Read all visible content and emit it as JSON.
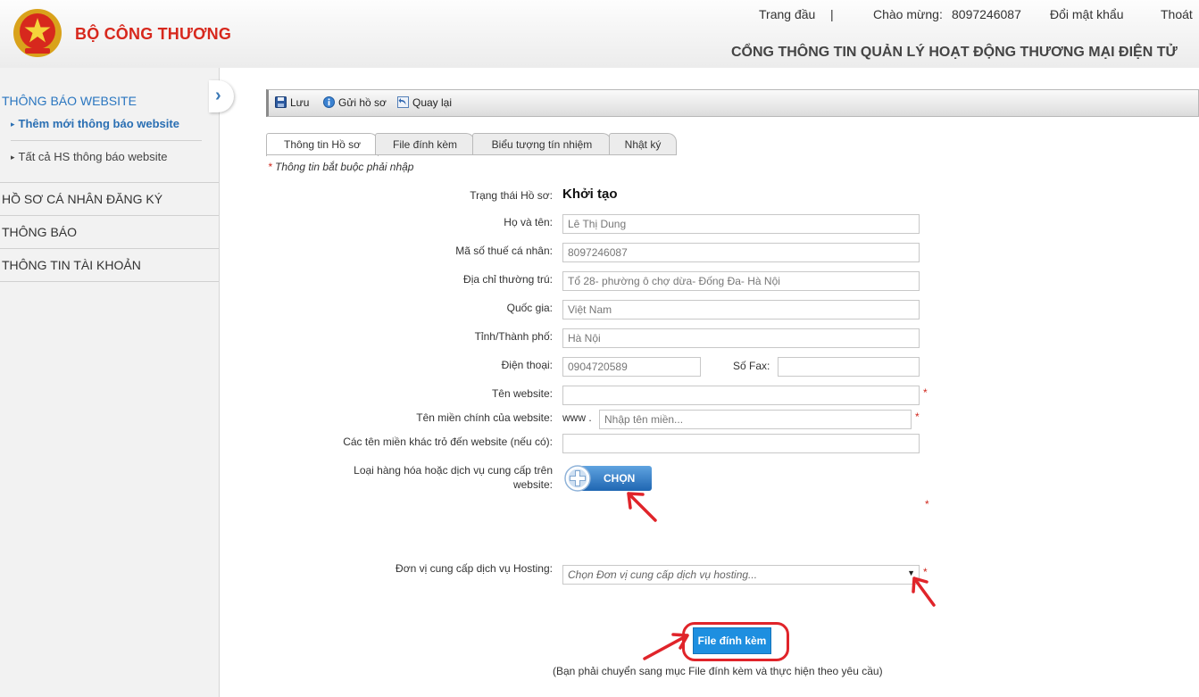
{
  "header": {
    "brand": "BỘ CÔNG THƯƠNG",
    "home_link": "Trang đầu",
    "separator": "|",
    "greeting_label": "Chào mừng:",
    "username": "8097246087",
    "change_password": "Đổi mật khẩu",
    "logout": "Thoát",
    "portal_title": "CỔNG THÔNG TIN QUẢN LÝ HOẠT ĐỘNG THƯƠNG MẠI ĐIỆN TỬ"
  },
  "sidebar": {
    "website_notice": {
      "title": "THÔNG BÁO WEBSITE",
      "items": [
        "Thêm mới thông báo website",
        "Tất cả HS thông báo website"
      ]
    },
    "sections": [
      "HỒ SƠ CÁ NHÂN ĐĂNG KÝ",
      "THÔNG BÁO",
      "THÔNG TIN TÀI KHOẢN"
    ]
  },
  "toolbar": {
    "save": "Lưu",
    "submit": "Gửi hồ sơ",
    "back": "Quay lại"
  },
  "tabs": [
    "Thông tin Hồ sơ",
    "File đính kèm",
    "Biểu tượng tín nhiệm",
    "Nhật ký"
  ],
  "form": {
    "required_star": "*",
    "required_note": "Thông tin bắt buộc phải nhập",
    "status_label": "Trạng thái Hồ sơ:",
    "status_value": "Khởi tạo",
    "fullname_label": "Họ và tên:",
    "fullname_value": "Lê Thị Dung",
    "tax_label": "Mã số thuế cá nhân:",
    "tax_value": "8097246087",
    "address_label": "Địa chỉ thường trú:",
    "address_value": "Tổ 28- phường ô chợ dừa- Đống Đa- Hà Nội",
    "country_label": "Quốc gia:",
    "country_value": "Việt Nam",
    "province_label": "Tỉnh/Thành phố:",
    "province_value": "Hà Nội",
    "phone_label": "Điện thoại:",
    "phone_value": "0904720589",
    "fax_label": "Số Fax:",
    "fax_value": "",
    "website_name_label": "Tên website:",
    "website_name_value": "",
    "domain_label": "Tên miền chính của website:",
    "domain_prefix": "www .",
    "domain_placeholder": "Nhập tên miền...",
    "other_domains_label": "Các tên miền khác trỏ đến website (nếu có):",
    "other_domains_value": "",
    "goods_label_line1": "Loại hàng hóa hoặc dịch vụ cung cấp trên",
    "goods_label_line2": "website:",
    "choose_button": "CHỌN",
    "hosting_label": "Đơn vị cung cấp dịch vụ Hosting:",
    "hosting_placeholder": "Chọn Đơn vị cung cấp dịch vụ hosting...",
    "attach_button": "File đính kèm",
    "attach_note": "(Bạn phải chuyển sang mục File đính kèm và thực hiện theo yêu cầu)"
  },
  "colors": {
    "brand_red": "#d7281d",
    "link_blue": "#2a76c0",
    "button_blue": "#1e8fe0",
    "annotation_red": "#e0242a"
  }
}
